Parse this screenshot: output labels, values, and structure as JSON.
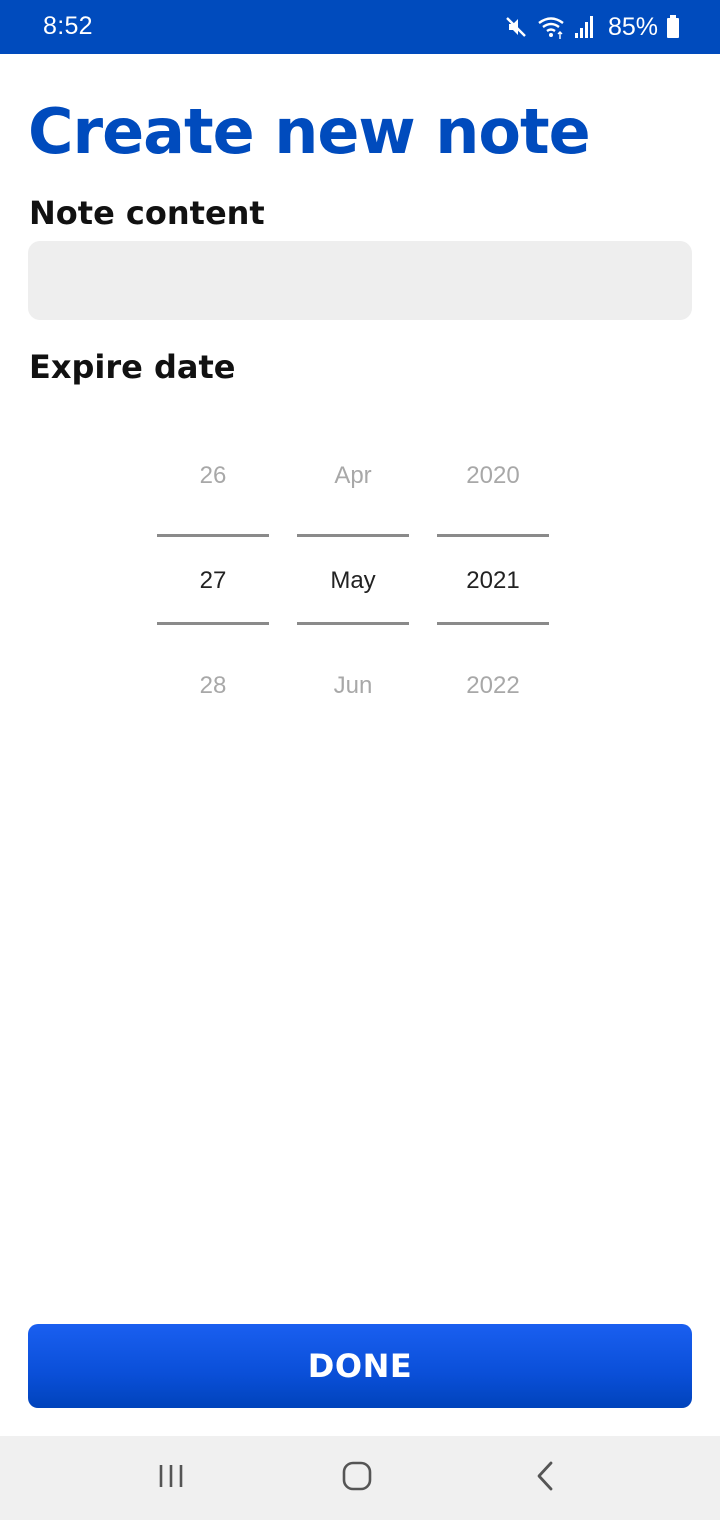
{
  "status_bar": {
    "time": "8:52",
    "battery": "85%",
    "icons": [
      "mute-icon",
      "wifi-icon",
      "signal-icon",
      "battery-icon"
    ]
  },
  "page": {
    "title": "Create new note"
  },
  "note_content": {
    "label": "Note content",
    "value": "",
    "placeholder": ""
  },
  "expire_date": {
    "label": "Expire date",
    "day": {
      "prev": "26",
      "selected": "27",
      "next": "28"
    },
    "month": {
      "prev": "Apr",
      "selected": "May",
      "next": "Jun"
    },
    "year": {
      "prev": "2020",
      "selected": "2021",
      "next": "2022"
    }
  },
  "done_button": {
    "label": "DONE"
  },
  "nav_bar": {
    "icons": [
      "recent-apps-icon",
      "home-icon",
      "back-icon"
    ]
  },
  "colors": {
    "brand": "#004bbd",
    "button": "#0a4fd8",
    "input_bg": "#eeeeee",
    "nav_bg": "#f0f0f0"
  }
}
